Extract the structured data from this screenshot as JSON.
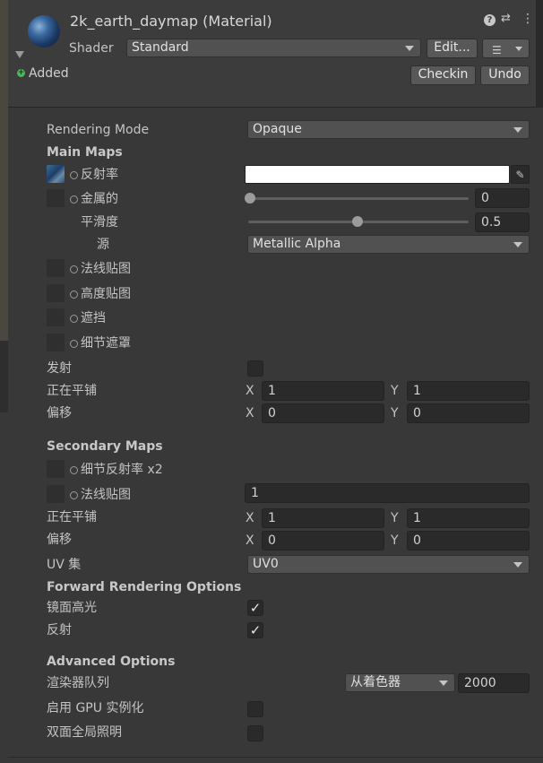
{
  "header": {
    "title": "2k_earth_daymap (Material)",
    "shader_label": "Shader",
    "shader_value": "Standard",
    "edit_button": "Edit...",
    "status": "Added",
    "checkin_button": "Checkin",
    "undo_button": "Undo"
  },
  "rendering_mode": {
    "label": "Rendering Mode",
    "value": "Opaque"
  },
  "main_maps": {
    "heading": "Main Maps",
    "albedo_label": "反射率",
    "metallic_label": "金属的",
    "metallic_value": "0",
    "smoothness_label": "平滑度",
    "smoothness_value": "0.5",
    "source_label": "源",
    "source_value": "Metallic Alpha",
    "normal_label": "法线贴图",
    "height_label": "高度贴图",
    "occlusion_label": "遮挡",
    "detail_mask_label": "细节遮罩",
    "emission_label": "发射",
    "tiling_label": "正在平铺",
    "tiling_x": "1",
    "tiling_y": "1",
    "offset_label": "偏移",
    "offset_x": "0",
    "offset_y": "0",
    "x_letter": "X",
    "y_letter": "Y"
  },
  "secondary_maps": {
    "heading": "Secondary Maps",
    "detail_albedo_label": "细节反射率 x2",
    "normal_label": "法线贴图",
    "normal_value": "1",
    "tiling_label": "正在平铺",
    "tiling_x": "1",
    "tiling_y": "1",
    "offset_label": "偏移",
    "offset_x": "0",
    "offset_y": "0",
    "uv_label": "UV 集",
    "uv_value": "UV0"
  },
  "forward_options": {
    "heading": "Forward Rendering Options",
    "specular_label": "镜面高光",
    "specular_checked": true,
    "reflections_label": "反射",
    "reflections_checked": true
  },
  "advanced_options": {
    "heading": "Advanced Options",
    "render_queue_label": "渲染器队列",
    "render_queue_mode": "从着色器",
    "render_queue_value": "2000",
    "gpu_instancing_label": "启用 GPU 实例化",
    "gpu_instancing_checked": false,
    "double_sided_gi_label": "双面全局照明",
    "double_sided_gi_checked": false
  },
  "colors": {
    "background": "#383838",
    "header": "#3c3c3c",
    "field": "#2a2a2a",
    "added_green": "#52b45c",
    "albedo_swatch": "#ffffff"
  }
}
